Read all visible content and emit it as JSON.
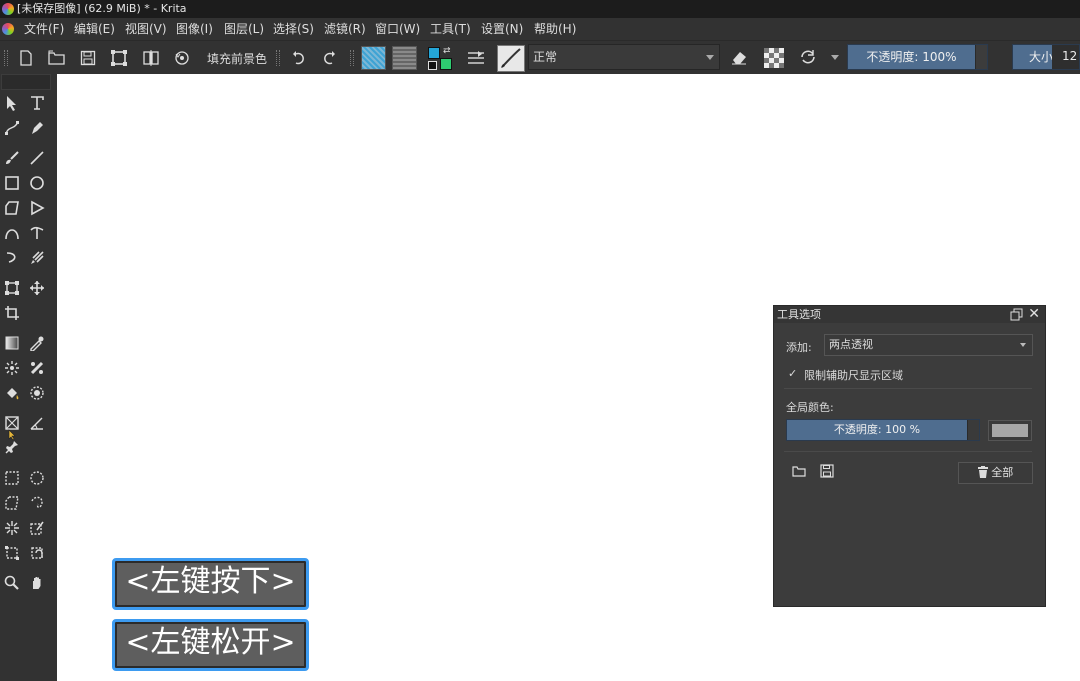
{
  "window": {
    "title": "[未保存图像]  (62.9 MiB) * - Krita"
  },
  "menu": [
    "文件(F)",
    "编辑(E)",
    "视图(V)",
    "图像(I)",
    "图层(L)",
    "选择(S)",
    "滤镜(R)",
    "窗口(W)",
    "工具(T)",
    "设置(N)",
    "帮助(H)"
  ],
  "toolbar": {
    "fill_label": "填充前景色",
    "blend_mode": "正常",
    "opacity_label": "不透明度:  100%",
    "size_label": "大小:",
    "size_value": "12",
    "fg_color": "#24a6d8",
    "bg_color": "#2ecc71"
  },
  "tool_options": {
    "title": "工具选项",
    "add_label": "添加:",
    "add_value": "两点透视",
    "limit_checkbox": "限制辅助尺显示区域",
    "limit_checked": true,
    "global_color_label": "全局颜色:",
    "opacity": "不透明度:  100 %",
    "swatch_color": "#a7a7a7",
    "all_button": "全部"
  },
  "overlay": {
    "press": "<左键按下>",
    "release": "<左键松开>"
  }
}
